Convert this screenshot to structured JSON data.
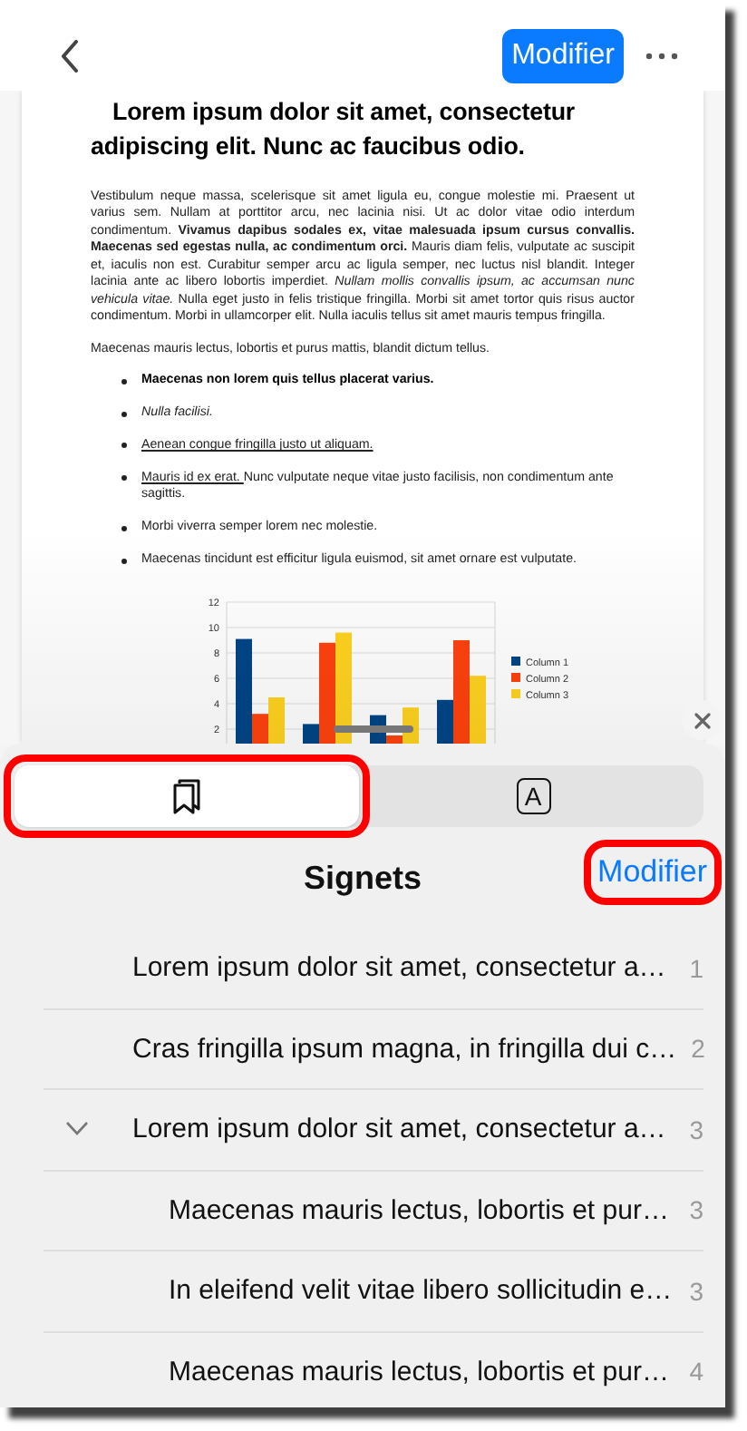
{
  "nav_bar": {
    "edit_button": "Modifier"
  },
  "document": {
    "title": "Lorem ipsum dolor sit amet, consectetur adipiscing elit. Nunc ac faucibus odio.",
    "paragraphs": [
      "Vestibulum neque massa, scelerisque sit amet ligula eu, congue molestie mi. Praesent ut varius sem. Nullam at porttitor arcu, nec lacinia nisi. Ut ac dolor vitae odio interdum condimentum. **Vivamus dapibus sodales ex, vitae malesuada ipsum cursus convallis. Maecenas sed egestas nulla, ac condimentum orci.** Mauris diam felis, vulputate ac suscipit et, iaculis non est. Curabitur semper arcu ac ligula semper, nec luctus nisl blandit. Integer lacinia ante ac libero lobortis imperdiet. *Nullam mollis convallis ipsum, ac accumsan nunc vehicula vitae.* Nulla eget justo in felis tristique fringilla. Morbi sit amet tortor quis risus auctor condimentum. Morbi in ullamcorper elit. Nulla iaculis tellus sit amet mauris tempus fringilla.",
      "Maecenas mauris lectus, lobortis et purus mattis, blandit dictum tellus."
    ],
    "bullets": [
      {
        "kind": "bold",
        "text": "Maecenas non lorem quis tellus placerat varius."
      },
      {
        "kind": "italic",
        "text": "Nulla facilisi."
      },
      {
        "kind": "underline",
        "text": "Aenean congue fringilla justo ut aliquam. "
      },
      {
        "kind": "underline",
        "text": "Mauris id ex erat. ",
        "tail": "Nunc vulputate neque vitae justo facilisis, non condimentum ante sagittis."
      },
      {
        "kind": "plain",
        "text": "Morbi viverra semper lorem nec molestie."
      },
      {
        "kind": "plain",
        "text": "Maecenas tincidunt est efficitur ligula euismod, sit amet ornare est vulputate."
      }
    ],
    "chart_data": {
      "type": "bar",
      "grid": true,
      "legend": true,
      "ylim": [
        0,
        12
      ],
      "yticks": [
        {
          "value": 2,
          "label": "2"
        },
        {
          "value": 4,
          "label": "4"
        },
        {
          "value": 6,
          "label": "6"
        },
        {
          "value": 8,
          "label": "8"
        },
        {
          "value": 10,
          "label": "10"
        },
        {
          "value": 12,
          "label": "12"
        }
      ],
      "series": [
        {
          "name": "Column 1",
          "color": "#004586",
          "values": [
            9.1,
            2.4,
            3.1,
            4.3
          ]
        },
        {
          "name": "Column 2",
          "color": "#ff420e",
          "values": [
            3.2,
            8.8,
            1.5,
            9.0
          ]
        },
        {
          "name": "Column 3",
          "color": "#ffd320",
          "values": [
            4.5,
            9.6,
            3.7,
            6.2
          ]
        }
      ]
    }
  },
  "sheet": {
    "tabs": [
      {
        "kind": "bookmarks",
        "selected": true,
        "highlighted": true
      },
      {
        "kind": "outline",
        "label": "A",
        "selected": false,
        "highlighted": false
      }
    ],
    "title": "Signets",
    "edit_button": {
      "label": "Modifier",
      "highlighted": true
    },
    "bookmarks": [
      {
        "title": "Lorem ipsum dolor sit amet, consectetur a…",
        "page": "1",
        "expanded": false
      },
      {
        "title": "Cras fringilla ipsum magna, in fringilla dui c…",
        "page": "2",
        "expanded": false
      },
      {
        "title": "Lorem ipsum dolor sit amet, consectetur a…",
        "page": "3",
        "expanded": true,
        "children": [
          {
            "title": "Maecenas mauris lectus, lobortis et pur…",
            "page": "3"
          },
          {
            "title": "In eleifend velit vitae libero sollicitudin e…",
            "page": "3"
          },
          {
            "title": "Maecenas mauris lectus, lobortis et pur…",
            "page": "4"
          }
        ]
      }
    ]
  }
}
